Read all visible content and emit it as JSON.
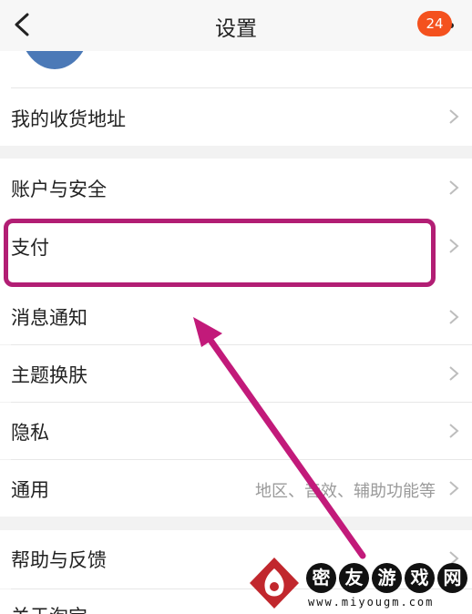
{
  "header": {
    "title": "设置",
    "back_icon": "chevron-left-icon",
    "more_icon": "more-dots-icon",
    "badge_count": "24"
  },
  "rows": {
    "address": {
      "label": "我的收货地址"
    },
    "account": {
      "label": "账户与安全"
    },
    "pay": {
      "label": "支付"
    },
    "notify": {
      "label": "消息通知"
    },
    "theme": {
      "label": "主题换肤"
    },
    "privacy": {
      "label": "隐私"
    },
    "general": {
      "label": "通用",
      "hint": "地区、音效、辅助功能等"
    },
    "help": {
      "label": "帮助与反馈"
    },
    "about": {
      "label": "关于淘宝"
    }
  },
  "annotation": {
    "highlight_color": "#b21e74",
    "arrow_color": "#c21a7a"
  },
  "watermark": {
    "chars": [
      "密",
      "友",
      "游",
      "戏",
      "网"
    ],
    "url": "www.miyougm.com"
  }
}
